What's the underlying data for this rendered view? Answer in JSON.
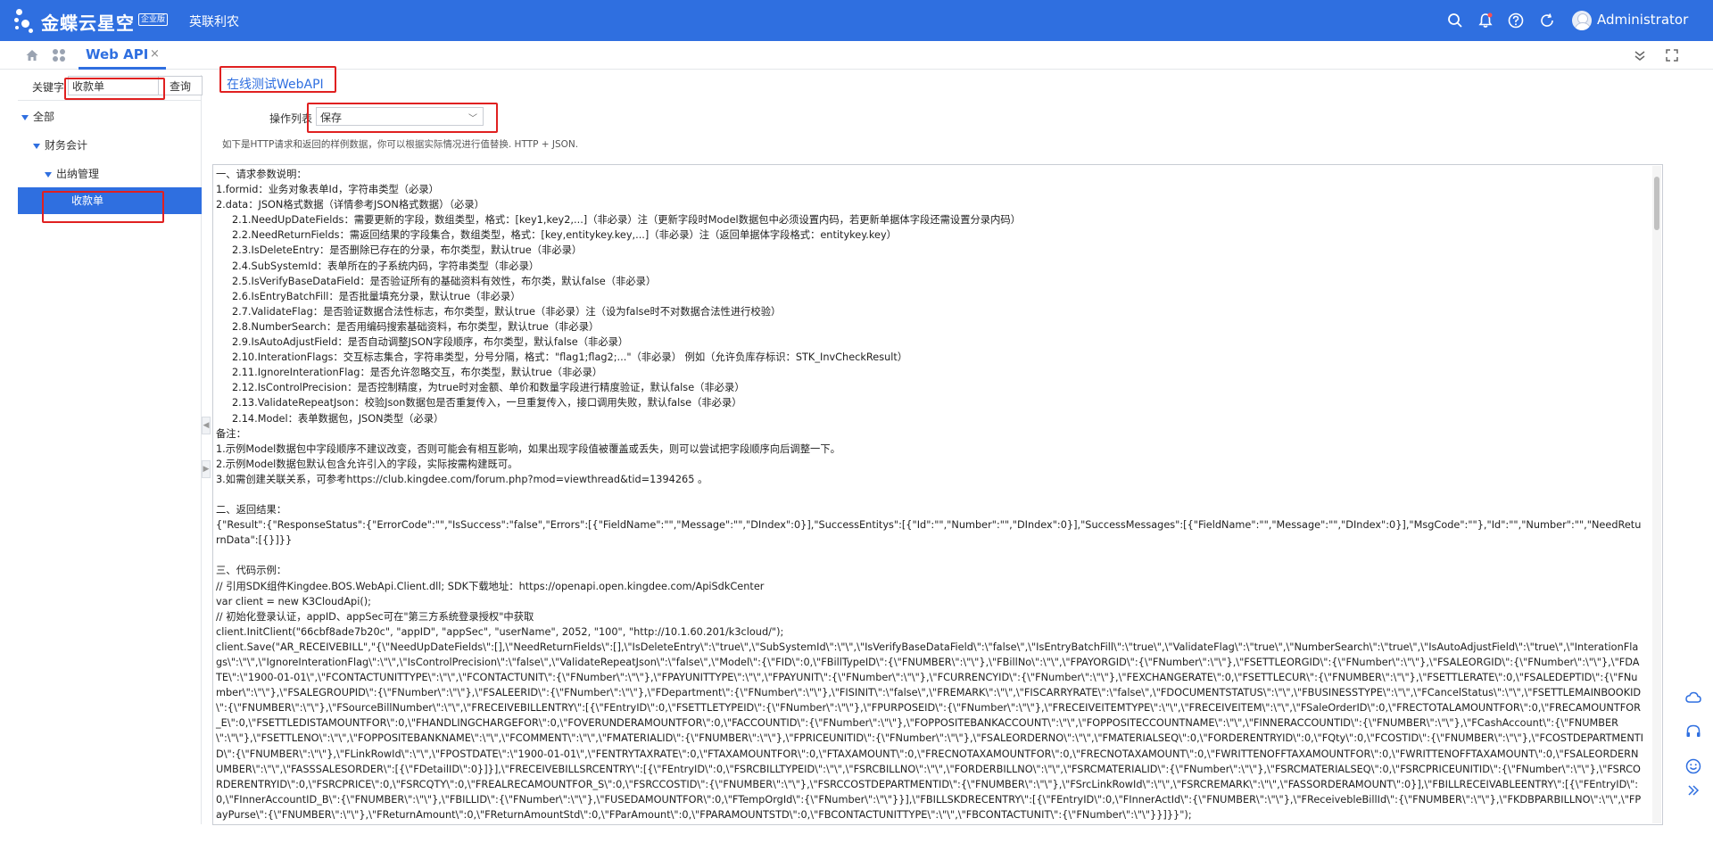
{
  "header": {
    "logo_text": "金蝶云星空",
    "logo_badge": "企业版",
    "org_name": "英联利农",
    "user_name": "Administrator",
    "icons": [
      "search-icon",
      "bell-icon",
      "help-icon",
      "refresh-icon"
    ]
  },
  "tabs": {
    "items": [
      {
        "label": "Web API"
      }
    ],
    "close_glyph": "×"
  },
  "search": {
    "label": "关键字",
    "value": "收款单",
    "button_label": "查询"
  },
  "tree": {
    "items": [
      {
        "label": "全部",
        "level": 0
      },
      {
        "label": "财务会计",
        "level": 1
      },
      {
        "label": "出纳管理",
        "level": 2
      },
      {
        "label": "收款单",
        "level": 3,
        "selected": true
      }
    ]
  },
  "main": {
    "title": "在线测试WebAPI",
    "operation_label": "操作列表",
    "operation_value": "保存",
    "hint": "如下是HTTP请求和返回的样例数据，你可以根据实际情况进行值替换. HTTP + JSON.",
    "document": "一、请求参数说明：\n1.formid：业务对象表单Id，字符串类型（必录）\n2.data：JSON格式数据（详情参考JSON格式数据）（必录）\n     2.1.NeedUpDateFields：需要更新的字段，数组类型，格式：[key1,key2,...]（非必录）注（更新字段时Model数据包中必须设置内码，若更新单据体字段还需设置分录内码）\n     2.2.NeedReturnFields：需返回结果的字段集合，数组类型，格式：[key,entitykey.key,...]（非必录）注（返回单据体字段格式：entitykey.key）\n     2.3.IsDeleteEntry：是否删除已存在的分录，布尔类型，默认true（非必录）\n     2.4.SubSystemId：表单所在的子系统内码，字符串类型（非必录）\n     2.5.IsVerifyBaseDataField：是否验证所有的基础资料有效性，布尔类，默认false（非必录）\n     2.6.IsEntryBatchFill：是否批量填充分录，默认true（非必录）\n     2.7.ValidateFlag：是否验证数据合法性标志，布尔类型，默认true（非必录）注（设为false时不对数据合法性进行校验）\n     2.8.NumberSearch：是否用编码搜索基础资料，布尔类型，默认true（非必录）\n     2.9.IsAutoAdjustField：是否自动调整JSON字段顺序，布尔类型，默认false（非必录）\n     2.10.InterationFlags：交互标志集合，字符串类型，分号分隔，格式：\"flag1;flag2;...\"（非必录） 例如（允许负库存标识：STK_InvCheckResult）\n     2.11.IgnoreInterationFlag：是否允许忽略交互，布尔类型，默认true（非必录）\n     2.12.IsControlPrecision：是否控制精度，为true时对金额、单价和数量字段进行精度验证，默认false（非必录）\n     2.13.ValidateRepeatJson：校验Json数据包是否重复传入，一旦重复传入，接口调用失败，默认false（非必录）\n     2.14.Model：表单数据包，JSON类型（必录）\n备注：\n1.示例Model数据包中字段顺序不建议改变，否则可能会有相互影响，如果出现字段值被覆盖或丢失，则可以尝试把字段顺序向后调整一下。\n2.示例Model数据包默认包含允许引入的字段，实际按需构建既可。\n3.如需创建关联关系，可参考https://club.kingdee.com/forum.php?mod=viewthread&tid=1394265 。\n\n二、返回结果：\n{\"Result\":{\"ResponseStatus\":{\"ErrorCode\":\"\",\"IsSuccess\":\"false\",\"Errors\":[{\"FieldName\":\"\",\"Message\":\"\",\"DIndex\":0}],\"SuccessEntitys\":[{\"Id\":\"\",\"Number\":\"\",\"DIndex\":0}],\"SuccessMessages\":[{\"FieldName\":\"\",\"Message\":\"\",\"DIndex\":0}],\"MsgCode\":\"\"},\"Id\":\"\",\"Number\":\"\",\"NeedReturnData\":[{}]}}\n\n三、代码示例：\n// 引用SDK组件Kingdee.BOS.WebApi.Client.dll; SDK下载地址：https://openapi.open.kingdee.com/ApiSdkCenter\nvar client = new K3CloudApi();\n// 初始化登录认证，appID、appSec可在\"第三方系统登录授权\"中获取\nclient.InitClient(\"66cbf8ade7b20c\", \"appID\", \"appSec\", \"userName\", 2052, \"100\", \"http://10.1.60.201/k3cloud/\");\nclient.Save(\"AR_RECEIVEBILL\",\"{\\\"NeedUpDateFields\\\":[],\\\"NeedReturnFields\\\":[],\\\"IsDeleteEntry\\\":\\\"true\\\",\\\"SubSystemId\\\":\\\"\\\",\\\"IsVerifyBaseDataField\\\":\\\"false\\\",\\\"IsEntryBatchFill\\\":\\\"true\\\",\\\"ValidateFlag\\\":\\\"true\\\",\\\"NumberSearch\\\":\\\"true\\\",\\\"IsAutoAdjustField\\\":\\\"true\\\",\\\"InterationFlags\\\":\\\"\\\",\\\"IgnoreInterationFlag\\\":\\\"\\\",\\\"IsControlPrecision\\\":\\\"false\\\",\\\"ValidateRepeatJson\\\":\\\"false\\\",\\\"Model\\\":{\\\"FID\\\":0,\\\"FBillTypeID\\\":{\\\"FNUMBER\\\":\\\"\\\"},\\\"FBillNo\\\":\\\"\\\",\\\"FPAYORGID\\\":{\\\"FNumber\\\":\\\"\\\"},\\\"FSETTLEORGID\\\":{\\\"FNumber\\\":\\\"\\\"},\\\"FSALEORGID\\\":{\\\"FNumber\\\":\\\"\\\"},\\\"FDATE\\\":\\\"1900-01-01\\\",\\\"FCONTACTUNITTYPE\\\":\\\"\\\",\\\"FCONTACTUNIT\\\":{\\\"FNumber\\\":\\\"\\\"},\\\"FPAYUNITTYPE\\\":\\\"\\\",\\\"FPAYUNIT\\\":{\\\"FNumber\\\":\\\"\\\"},\\\"FCURRENCYID\\\":{\\\"FNumber\\\":\\\"\\\"},\\\"FEXCHANGERATE\\\":0,\\\"FSETTLECUR\\\":{\\\"FNUMBER\\\":\\\"\\\"},\\\"FSETTLERATE\\\":0,\\\"FSALEDEPTID\\\":{\\\"FNumber\\\":\\\"\\\"},\\\"FSALEGROUPID\\\":{\\\"FNumber\\\":\\\"\\\"},\\\"FSALEERID\\\":{\\\"FNumber\\\":\\\"\\\"},\\\"FDepartment\\\":{\\\"FNumber\\\":\\\"\\\"},\\\"FISINIT\\\":\\\"false\\\",\\\"FREMARK\\\":\\\"\\\",\\\"FISCARRYRATE\\\":\\\"false\\\",\\\"FDOCUMENTSTATUS\\\":\\\"\\\",\\\"FBUSINESSTYPE\\\":\\\"\\\",\\\"FCancelStatus\\\":\\\"\\\",\\\"FSETTLEMAINBOOKID\\\":{\\\"FNUMBER\\\":\\\"\\\"},\\\"FSourceBillNumber\\\":\\\"\\\",\\\"FRECEIVEBILLENTRY\\\":[{\\\"FEntryID\\\":0,\\\"FSETTLETYPEID\\\":{\\\"FNumber\\\":\\\"\\\"},\\\"FPURPOSEID\\\":{\\\"FNumber\\\":\\\"\\\"},\\\"FRECEIVEITEMTYPE\\\":\\\"\\\",\\\"FRECEIVEITEM\\\":\\\"\\\",\\\"FSaleOrderID\\\":0,\\\"FRECTOTALAMOUNTFOR\\\":0,\\\"FRECAMOUNTFOR_E\\\":0,\\\"FSETTLEDISTAMOUNTFOR\\\":0,\\\"FHANDLINGCHARGEFOR\\\":0,\\\"FOVERUNDERAMOUNTFOR\\\":0,\\\"FACCOUNTID\\\":{\\\"FNumber\\\":\\\"\\\"},\\\"FOPPOSITEBANKACCOUNT\\\":\\\"\\\",\\\"FOPPOSITECCOUNTNAME\\\":\\\"\\\",\\\"FINNERACCOUNTID\\\":{\\\"FNUMBER\\\":\\\"\\\"},\\\"FCashAccount\\\":{\\\"FNUMBER\\\":\\\"\\\"},\\\"FSETTLENO\\\":\\\"\\\",\\\"FOPPOSITEBANKNAME\\\":\\\"\\\",\\\"FCOMMENT\\\":\\\"\\\",\\\"FMATERIALID\\\":{\\\"FNUMBER\\\":\\\"\\\"},\\\"FPRICEUNITID\\\":{\\\"FNumber\\\":\\\"\\\"},\\\"FSALEORDERNO\\\":\\\"\\\",\\\"FMATERIALSEQ\\\":0,\\\"FORDERENTRYID\\\":0,\\\"FQty\\\":0,\\\"FCOSTID\\\":{\\\"FNUMBER\\\":\\\"\\\"},\\\"FCOSTDEPARTMENTID\\\":{\\\"FNUMBER\\\":\\\"\\\"},\\\"FLinkRowId\\\":\\\"\\\",\\\"FPOSTDATE\\\":\\\"1900-01-01\\\",\\\"FENTRYTAXRATE\\\":0,\\\"FTAXAMOUNTFOR\\\":0,\\\"FTAXAMOUNT\\\":0,\\\"FRECNOTAXAMOUNTFOR\\\":0,\\\"FRECNOTAXAMOUNT\\\":0,\\\"FWRITTENOFFTAXAMOUNTFOR\\\":0,\\\"FWRITTENOFFTAXAMOUNT\\\":0,\\\"FSALEORDERNUMBER\\\":\\\"\\\",\\\"FASSSALESORDER\\\":[{\\\"FDetailID\\\":0}]}],\\\"FRECEIVEBILLSRCENTRY\\\":[{\\\"FEntryID\\\":0,\\\"FSRCBILLTYPEID\\\":\\\"\\\",\\\"FSRCBILLNO\\\":\\\"\\\",\\\"FORDERBILLNO\\\":\\\"\\\",\\\"FSRCMATERIALID\\\":{\\\"FNumber\\\":\\\"\\\"},\\\"FSRCMATERIALSEQ\\\":0,\\\"FSRCPRICEUNITID\\\":{\\\"FNumber\\\":\\\"\\\"},\\\"FSRCORDERENTRYID\\\":0,\\\"FSRCPRICE\\\":0,\\\"FSRCQTY\\\":0,\\\"FREALRECAMOUNTFOR_S\\\":0,\\\"FSRCCOSTID\\\":{\\\"FNUMBER\\\":\\\"\\\"},\\\"FSRCCOSTDEPARTMENTID\\\":{\\\"FNUMBER\\\":\\\"\\\"},\\\"FSrcLinkRowId\\\":\\\"\\\",\\\"FSRCREMARK\\\":\\\"\\\",\\\"FASSORDERAMOUNT\\\":0}],\\\"FBILLRECEIVABLEENTRY\\\":[{\\\"FEntryID\\\":0,\\\"FInnerAccountID_B\\\":{\\\"FNUMBER\\\":\\\"\\\"},\\\"FBILLID\\\":{\\\"FNumber\\\":\\\"\\\"},\\\"FUSEDAMOUNTFOR\\\":0,\\\"FTempOrgId\\\":{\\\"FNumber\\\":\\\"\\\"}}],\\\"FBILLSKDRECENTRY\\\":[{\\\"FEntryID\\\":0,\\\"FInnerActId\\\":{\\\"FNUMBER\\\":\\\"\\\"},\\\"FReceivebleBillId\\\":{\\\"FNUMBER\\\":\\\"\\\"},\\\"FKDBPARBILLNO\\\":\\\"\\\",\\\"FPayPurse\\\":{\\\"FNUMBER\\\":\\\"\\\"},\\\"FReturnAmount\\\":0,\\\"FReturnAmountStd\\\":0,\\\"FParAmount\\\":0,\\\"FPARAMOUNTSTD\\\":0,\\\"FBCONTACTUNITTYPE\\\":\\\"\\\",\\\"FBCONTACTUNIT\\\":{\\\"FNumber\\\":\\\"\\\"}}]}}\");"
  },
  "rail": {
    "icons": [
      "cloud-icon",
      "headset-icon",
      "smile-icon",
      "double-chevron-right-icon"
    ]
  },
  "colors": {
    "brand": "#2f6fe0",
    "highlight": "#e02020"
  }
}
